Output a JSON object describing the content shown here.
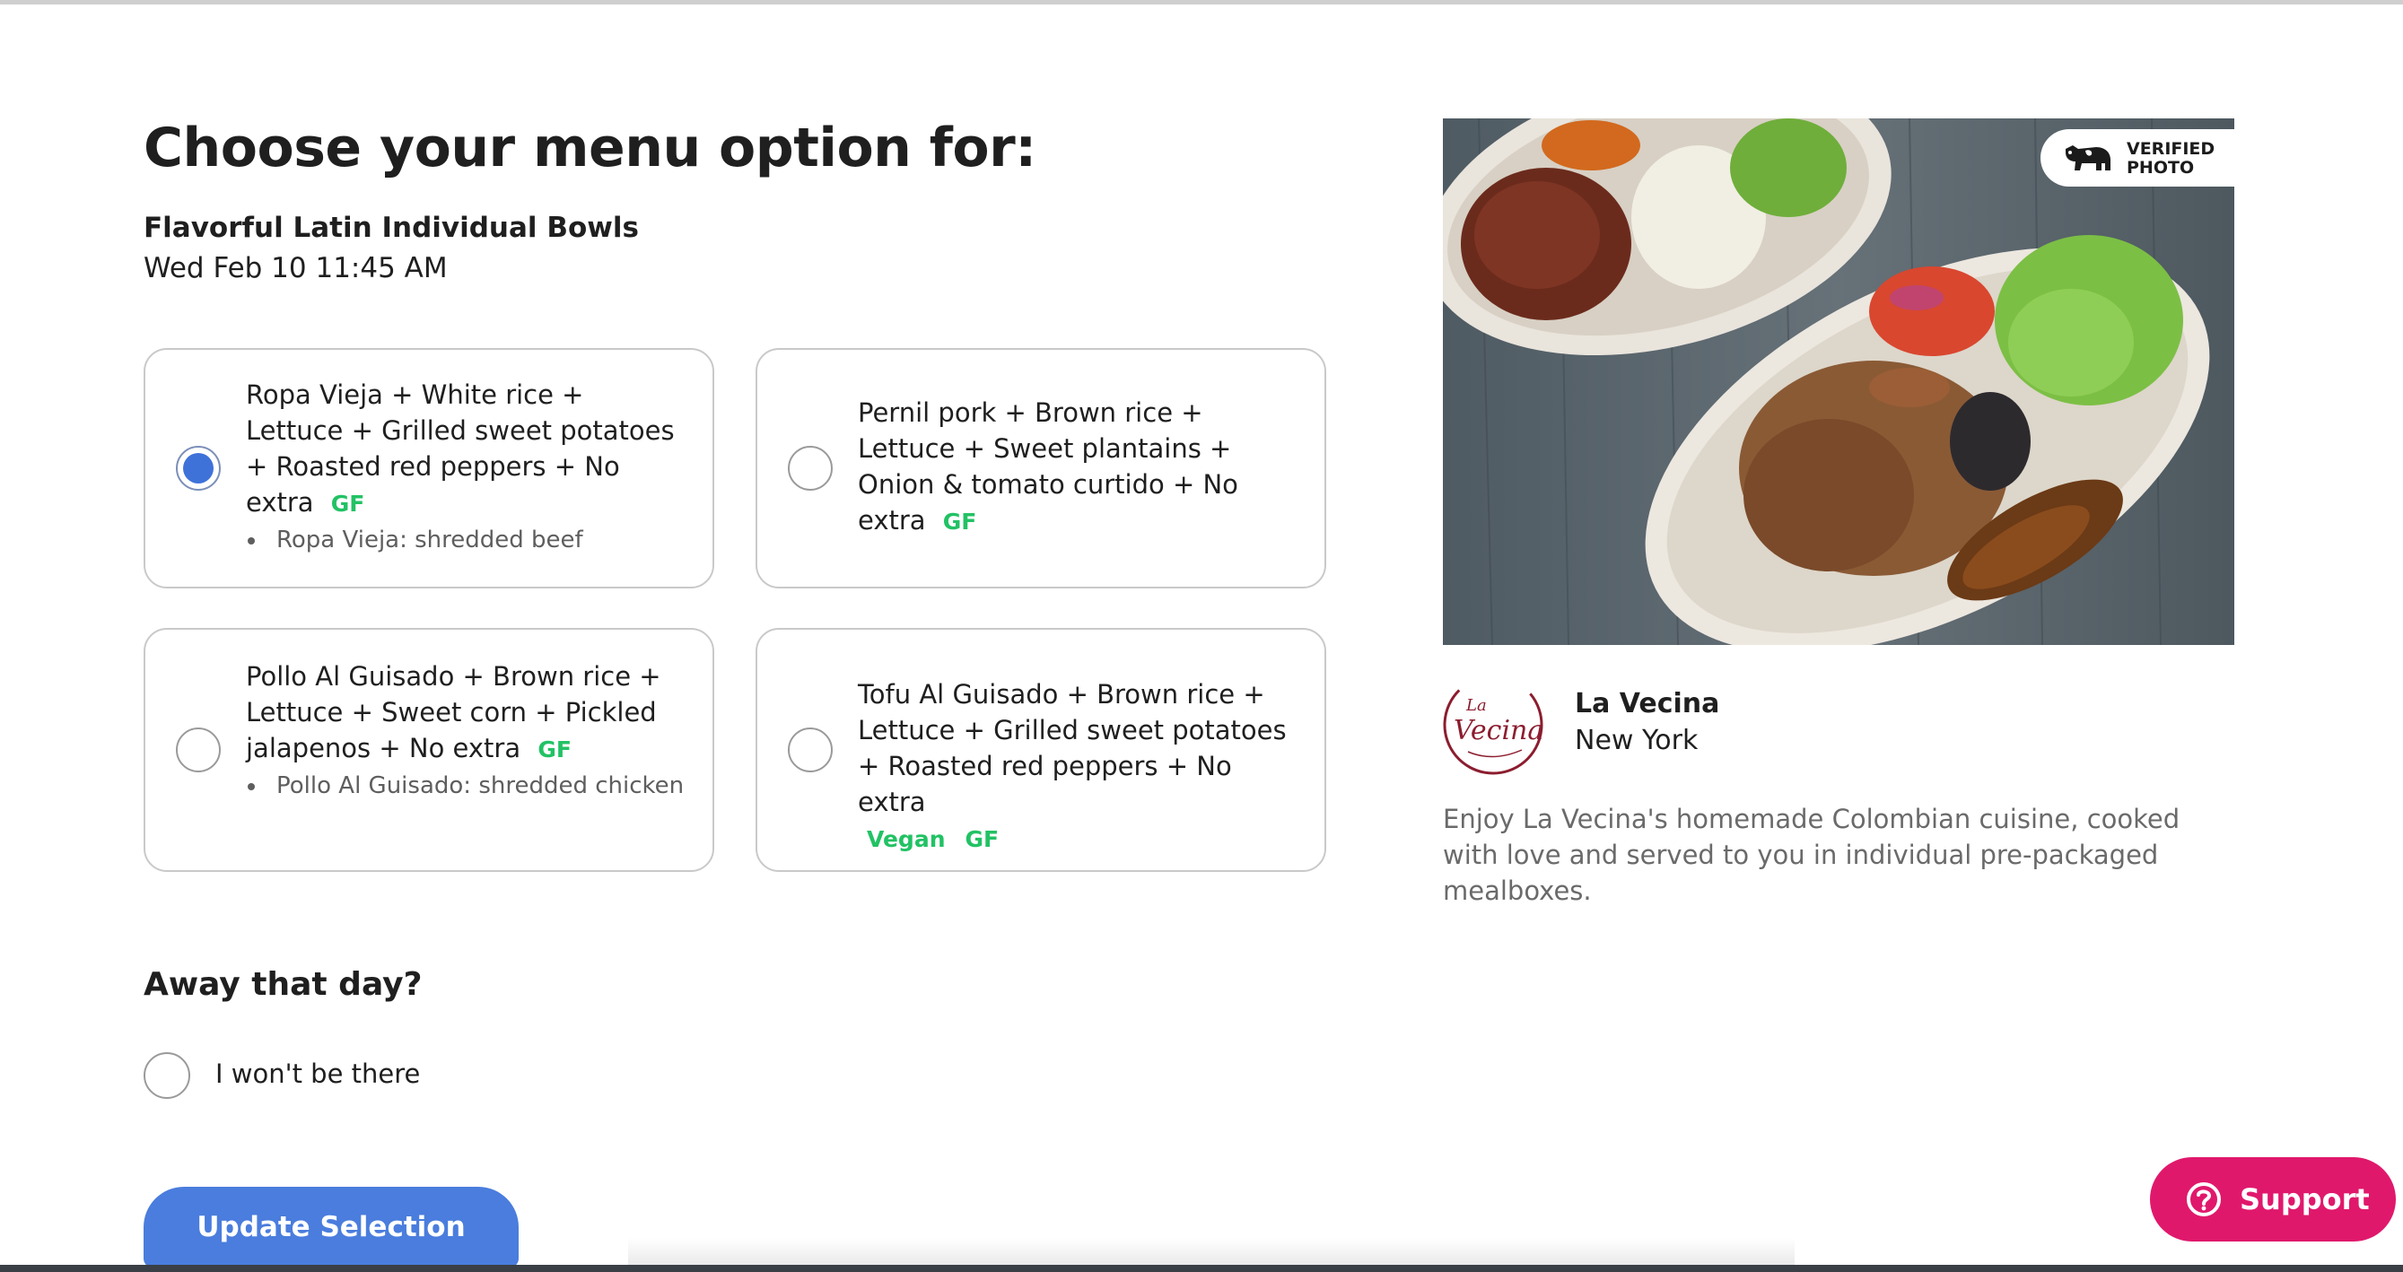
{
  "page": {
    "heading": "Choose your menu option for:",
    "meal_name": "Flavorful Latin Individual Bowls",
    "datetime": "Wed Feb 10 11:45 AM"
  },
  "options": [
    {
      "text": "Ropa Vieja + White rice + Lettuce + Grilled sweet potatoes + Roasted red peppers + No extra",
      "tags": [
        "GF"
      ],
      "note": "Ropa Vieja: shredded beef",
      "selected": true
    },
    {
      "text": "Pernil pork + Brown rice + Lettuce + Sweet plantains + Onion & tomato curtido + No extra",
      "tags": [
        "GF"
      ],
      "note": "",
      "selected": false
    },
    {
      "text": "Pollo Al Guisado + Brown rice + Lettuce + Sweet corn + Pickled jalapenos + No extra",
      "tags": [
        "GF"
      ],
      "note": "Pollo Al Guisado: shredded chicken",
      "selected": false
    },
    {
      "text": "Tofu Al Guisado + Brown rice + Lettuce + Grilled sweet potatoes + Roasted red peppers + No extra",
      "tags": [
        "Vegan",
        "GF"
      ],
      "note": "",
      "selected": false
    }
  ],
  "away": {
    "title": "Away that day?",
    "label": "I won't be there"
  },
  "update_button": "Update Selection",
  "photo": {
    "badge_text": "VERIFIED\nPHOTO",
    "badge_icon": "cow-icon"
  },
  "restaurant": {
    "logo_text": "La Vecina",
    "name": "La Vecina",
    "city": "New York",
    "description": "Enjoy La Vecina's homemade Colombian cuisine, cooked with love and served to you in individual pre-packaged mealboxes."
  },
  "support": {
    "label": "Support",
    "icon": "question-circle-icon"
  },
  "colors": {
    "accent_blue": "#4a7ddd",
    "selected_radio": "#3f72d9",
    "tag_green": "#22c264",
    "support_pink": "#e0186c"
  }
}
